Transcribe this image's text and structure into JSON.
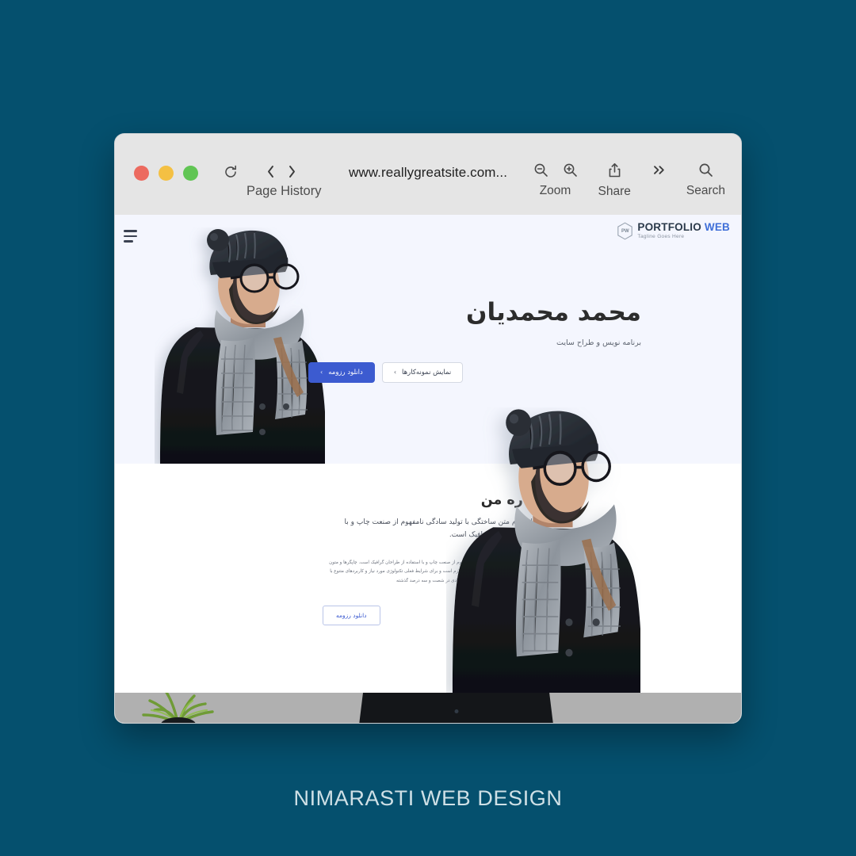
{
  "page": {
    "background_color": "#05506e",
    "caption": "NIMARASTI WEB DESIGN"
  },
  "browser": {
    "traffic_lights": [
      {
        "name": "close",
        "color": "#ec6a5f"
      },
      {
        "name": "minimize",
        "color": "#f4c043"
      },
      {
        "name": "maximize",
        "color": "#61c554"
      }
    ],
    "reload_icon": "reload-icon",
    "back_icon": "chevron-left-icon",
    "forward_icon": "chevron-right-icon",
    "page_history_label": "Page History",
    "url": "www.reallygreatsite.com...",
    "tools": [
      {
        "label": "Zoom",
        "icons": [
          "zoom-out-icon",
          "zoom-in-icon"
        ]
      },
      {
        "label": "Share",
        "icons": [
          "share-icon"
        ]
      },
      {
        "label": "",
        "icons": [
          "double-chevron-right-icon"
        ]
      },
      {
        "label": "Search",
        "icons": [
          "search-icon"
        ]
      }
    ]
  },
  "site": {
    "menu_icon": "hamburger-menu-icon",
    "logo": {
      "badge_text": "PW",
      "title_part1": "PORTFOLIO",
      "title_part2": "WEB",
      "tagline": "Tagline Goes Here",
      "accent_color": "#3f6fd8"
    },
    "hero": {
      "name": "محمد محمدیان",
      "subtitle": "برنامه نویس و طراح سایت",
      "primary_button": "دانلود رزومه",
      "secondary_button": "نمایش نمونه‌کارها",
      "chevron": "›",
      "background_color": "#f4f6fe",
      "primary_color": "#3c5bd0"
    },
    "about": {
      "title": "درباره من",
      "lead": "لورم ایپسوم متن ساختگی با تولید سادگی نامفهوم از صنعت چاپ و با استفاده از طراحان گرافیک است.",
      "body": "لورم ایپسوم متن ساختگی با تولید سادگی نامفهوم از صنعت چاپ و با استفاده از طراحان گرافیک است. چاپگرها و متون بلکه روزنامه و مجله در ستون و سطرآنچنان که لازم است و برای شرایط فعلی تکنولوژی مورد نیاز و کاربردهای متنوع با هدف بهبود ابزارهای کاربردی می باشد. کتابهای زیادی در شصت و سه درصد گذشته",
      "button": "دانلود رزومه"
    },
    "photos": [
      {
        "name": "hero-portrait-photo",
        "alt": "man with beanie glasses and knit scarf"
      },
      {
        "name": "about-portrait-photo",
        "alt": "man with beanie glasses and knit scarf"
      }
    ],
    "desk": {
      "name": "laptop-desk-strip",
      "plant": "potted-plant"
    }
  }
}
